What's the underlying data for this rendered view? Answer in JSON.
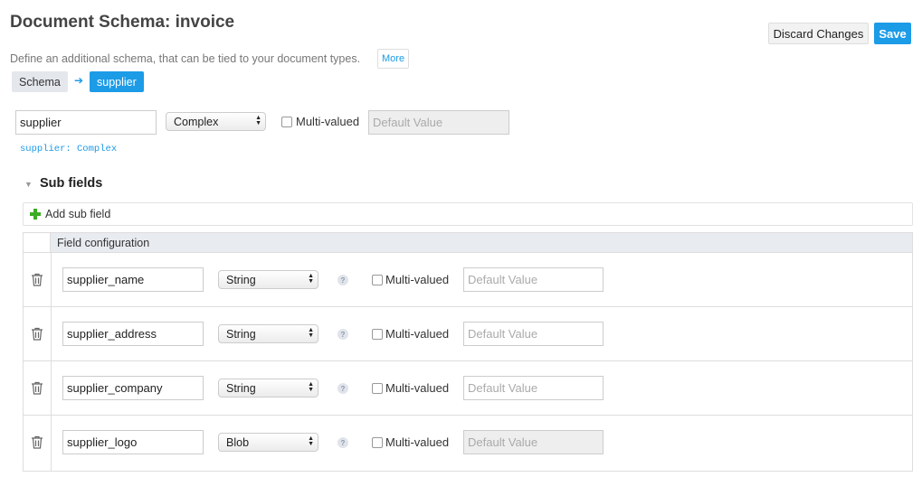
{
  "header": {
    "title": "Document Schema: invoice",
    "discard_label": "Discard Changes",
    "save_label": "Save",
    "description": "Define an additional schema, that can be tied to your document types.",
    "more_label": "More"
  },
  "breadcrumb": {
    "root": "Schema",
    "arrow": "➔",
    "current": "supplier"
  },
  "field": {
    "name": "supplier",
    "type": "Complex",
    "multivalued_label": "Multi-valued",
    "multivalued": false,
    "default_placeholder": "Default Value",
    "type_hint": "supplier: Complex"
  },
  "subfields": {
    "title": "Sub fields",
    "add_label": "Add sub field",
    "column_header": "Field configuration",
    "rows": [
      {
        "name": "supplier_name",
        "type": "String",
        "help": "?",
        "multivalued_label": "Multi-valued",
        "default_placeholder": "Default Value"
      },
      {
        "name": "supplier_address",
        "type": "String",
        "help": "?",
        "multivalued_label": "Multi-valued",
        "default_placeholder": "Default Value"
      },
      {
        "name": "supplier_company",
        "type": "String",
        "help": "?",
        "multivalued_label": "Multi-valued",
        "default_placeholder": "Default Value"
      },
      {
        "name": "supplier_logo",
        "type": "Blob",
        "help": "?",
        "multivalued_label": "Multi-valued",
        "default_placeholder": "Default Value"
      }
    ]
  },
  "colors": {
    "accent": "#1c9be7",
    "add_icon": "#3cac22"
  }
}
